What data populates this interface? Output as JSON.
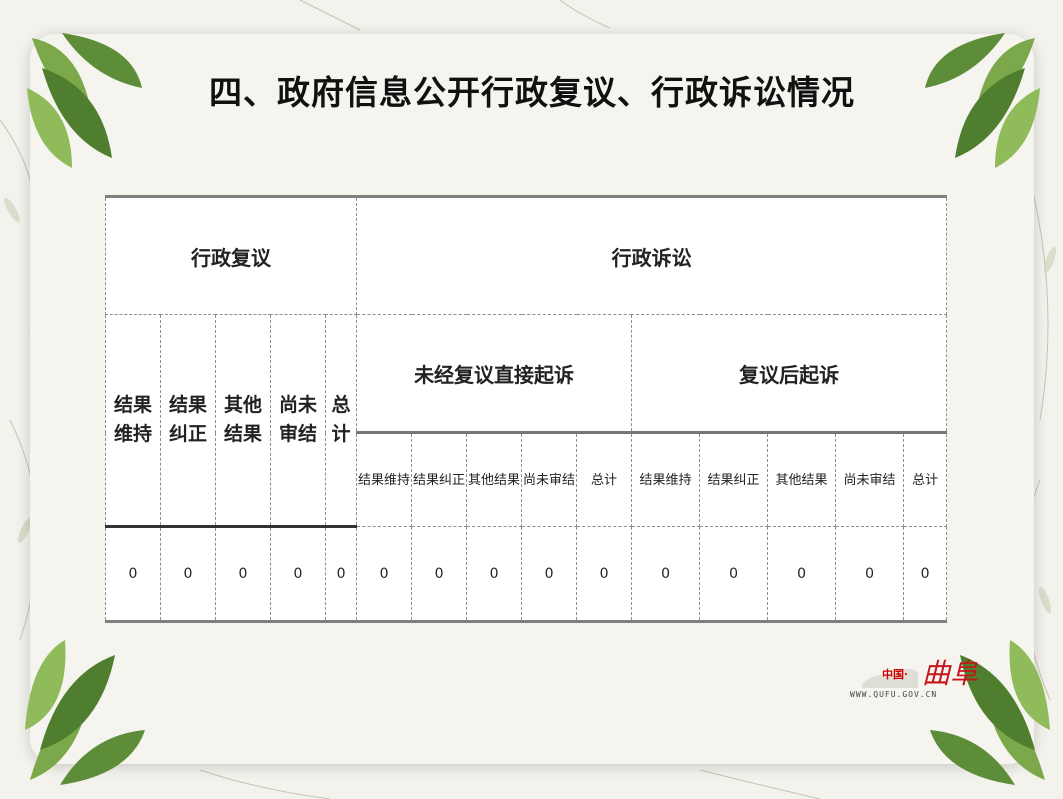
{
  "title": "四、政府信息公开行政复议、行政诉讼情况",
  "table": {
    "group_admin_review": "行政复议",
    "group_litigation": "行政诉讼",
    "sub_direct": "未经复议直接起诉",
    "sub_after_review": "复议后起诉",
    "review_cols": [
      "结果维持",
      "结果纠正",
      "其他结果",
      "尚未审结",
      "总计"
    ],
    "review_cols_display": [
      "结果\n维持",
      "结果\n纠正",
      "其他\n结果",
      "尚未\n审结",
      "总\n计"
    ],
    "direct_cols": [
      "结果维持",
      "结果纠正",
      "其他结果",
      "尚未审结",
      "总计"
    ],
    "after_cols": [
      "结果维持",
      "结果纠正",
      "其他结果",
      "尚未审结",
      "总计"
    ],
    "values": [
      "0",
      "0",
      "0",
      "0",
      "0",
      "0",
      "0",
      "0",
      "0",
      "0",
      "0",
      "0",
      "0",
      "0",
      "0"
    ]
  },
  "watermark": {
    "label": "中国·",
    "signature": "曲阜",
    "url": "WWW.QUFU.GOV.CN"
  },
  "colors": {
    "background": "#f3f2ec",
    "card": "#f5f4ef",
    "leaf_green": "#5f8f3a",
    "watermark_red": "#c4161c"
  }
}
